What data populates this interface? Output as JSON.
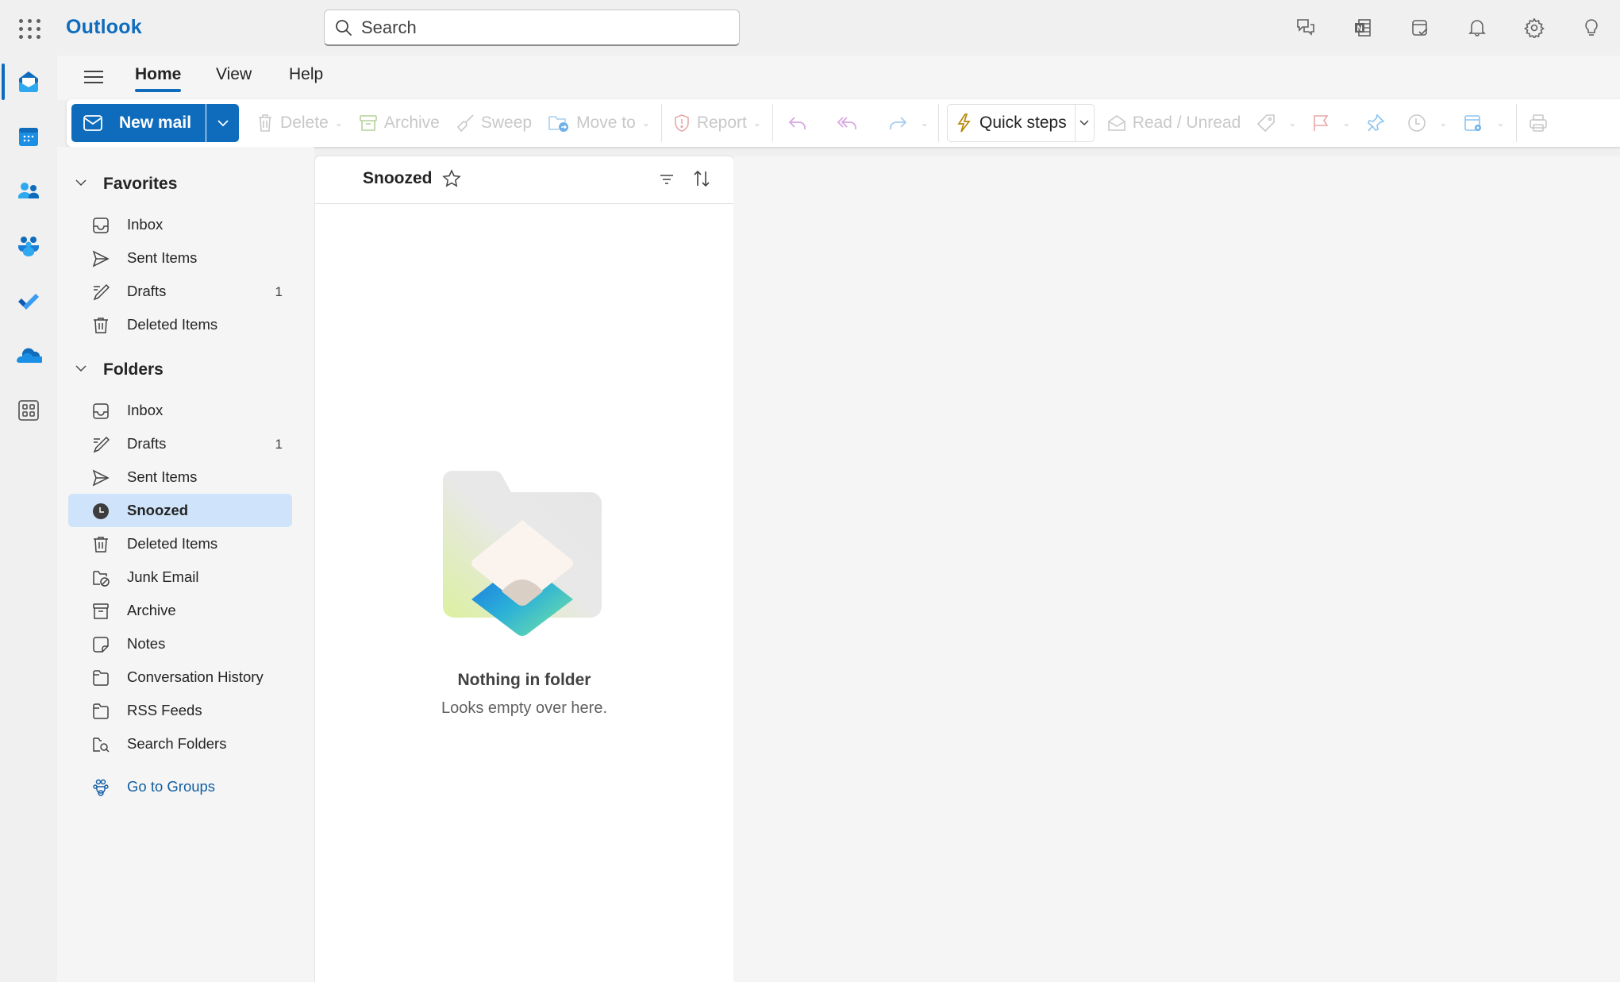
{
  "app": {
    "name": "Outlook",
    "brand_color": "#0f6cbd"
  },
  "search": {
    "placeholder": "Search",
    "value": ""
  },
  "top_icons": [
    "feedback-icon",
    "onenote-icon",
    "my-day-icon",
    "notifications-bell-icon",
    "settings-gear-icon",
    "tips-lightbulb-icon"
  ],
  "rail": {
    "items": [
      {
        "name": "mail",
        "active": true
      },
      {
        "name": "calendar",
        "active": false
      },
      {
        "name": "people",
        "active": false
      },
      {
        "name": "groups",
        "active": false
      },
      {
        "name": "to-do",
        "active": false
      },
      {
        "name": "onedrive",
        "active": false
      },
      {
        "name": "more-apps",
        "active": false
      }
    ]
  },
  "tabs": [
    {
      "label": "Home",
      "active": true
    },
    {
      "label": "View",
      "active": false
    },
    {
      "label": "Help",
      "active": false
    }
  ],
  "ribbon": {
    "new_mail": "New mail",
    "delete": "Delete",
    "archive": "Archive",
    "sweep": "Sweep",
    "move_to": "Move to",
    "report": "Report",
    "quick_steps": "Quick steps",
    "read_unread": "Read / Unread"
  },
  "folder_pane": {
    "favorites": {
      "label": "Favorites",
      "items": [
        {
          "label": "Inbox",
          "count": ""
        },
        {
          "label": "Sent Items",
          "count": ""
        },
        {
          "label": "Drafts",
          "count": "1"
        },
        {
          "label": "Deleted Items",
          "count": ""
        }
      ]
    },
    "folders": {
      "label": "Folders",
      "items": [
        {
          "label": "Inbox",
          "count": ""
        },
        {
          "label": "Drafts",
          "count": "1"
        },
        {
          "label": "Sent Items",
          "count": ""
        },
        {
          "label": "Snoozed",
          "count": "",
          "selected": true
        },
        {
          "label": "Deleted Items",
          "count": ""
        },
        {
          "label": "Junk Email",
          "count": ""
        },
        {
          "label": "Archive",
          "count": ""
        },
        {
          "label": "Notes",
          "count": ""
        },
        {
          "label": "Conversation History",
          "count": ""
        },
        {
          "label": "RSS Feeds",
          "count": ""
        },
        {
          "label": "Search Folders",
          "count": ""
        }
      ]
    },
    "go_to_groups": "Go to Groups"
  },
  "message_list": {
    "title": "Snoozed",
    "empty_title": "Nothing in folder",
    "empty_subtitle": "Looks empty over here."
  }
}
